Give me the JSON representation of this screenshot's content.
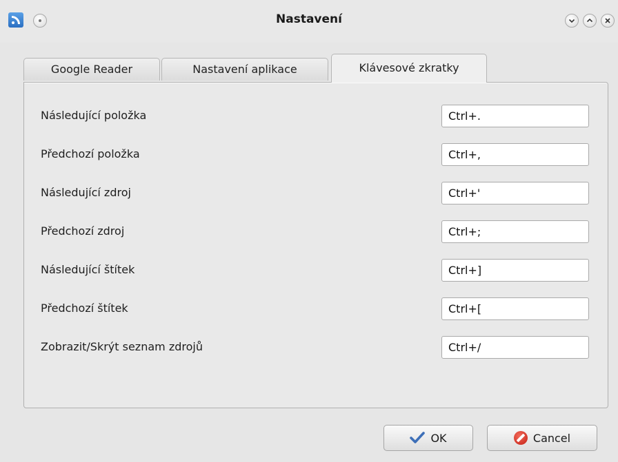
{
  "window": {
    "title": "Nastavení"
  },
  "icons": {
    "app": "rss-feed-icon",
    "menu": "window-menu-icon",
    "minimize": "chevron-down-icon",
    "maximize": "chevron-up-icon",
    "close": "close-icon",
    "ok": "check-icon",
    "cancel": "cancel-icon"
  },
  "tabs": [
    {
      "label": "Google Reader",
      "active": false
    },
    {
      "label": "Nastavení aplikace",
      "active": false
    },
    {
      "label": "Klávesové zkratky",
      "active": true
    }
  ],
  "shortcuts": [
    {
      "label": "Následující položka",
      "value": "Ctrl+."
    },
    {
      "label": "Předchozí položka",
      "value": "Ctrl+,"
    },
    {
      "label": "Následující zdroj",
      "value": "Ctrl+'"
    },
    {
      "label": "Předchozí zdroj",
      "value": "Ctrl+;"
    },
    {
      "label": "Následující štítek",
      "value": "Ctrl+]"
    },
    {
      "label": "Předchozí štítek",
      "value": "Ctrl+["
    },
    {
      "label": "Zobrazit/Skrýt seznam zdrojů",
      "value": "Ctrl+/"
    }
  ],
  "buttons": {
    "ok": "OK",
    "cancel": "Cancel"
  },
  "colors": {
    "cancel_icon": "#d9261b",
    "ok_icon": "#3d6fb8"
  }
}
